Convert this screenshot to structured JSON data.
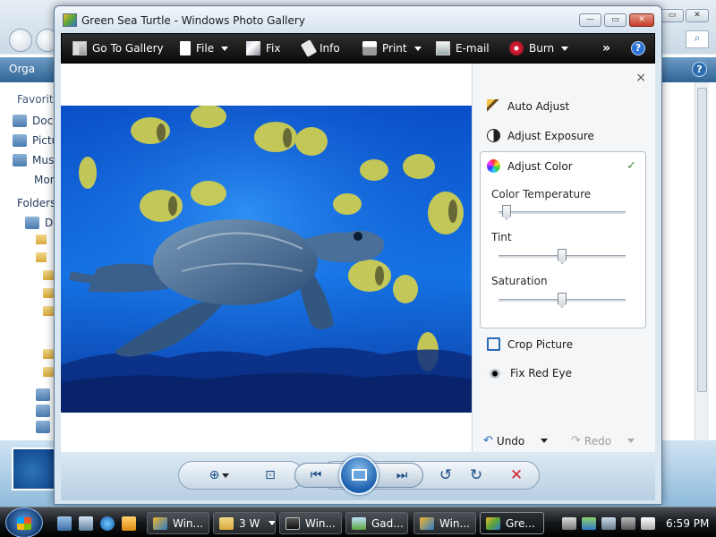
{
  "window_title": "Green Sea Turtle - Windows Photo Gallery",
  "caption_buttons": {
    "minimize": "—",
    "maximize": "▭",
    "close": "✕"
  },
  "toolbar": {
    "go_to_gallery": "Go To Gallery",
    "file": "File",
    "fix": "Fix",
    "info": "Info",
    "print": "Print",
    "email": "E-mail",
    "burn": "Burn",
    "more": "»",
    "help": "?"
  },
  "fix_pane": {
    "close": "×",
    "auto_adjust": "Auto Adjust",
    "adjust_exposure": "Adjust Exposure",
    "adjust_color": "Adjust Color",
    "check": "✓",
    "sliders": [
      {
        "label": "Color Temperature",
        "value": 0.03
      },
      {
        "label": "Tint",
        "value": 0.5
      },
      {
        "label": "Saturation",
        "value": 0.5
      }
    ],
    "crop_picture": "Crop Picture",
    "fix_red_eye": "Fix Red Eye",
    "undo": "Undo",
    "redo": "Redo"
  },
  "controls": {
    "zoom": "⊕",
    "actual_size": "⊡",
    "previous": "⏮",
    "next": "⏭",
    "rotate_ccw": "↺",
    "rotate_cw": "↻",
    "delete": "✕"
  },
  "background_window": {
    "search_icon": "⌕",
    "help": "?",
    "organize": "Orga",
    "favorites": "Favorite",
    "docs": "Doc",
    "pictures": "Pictu",
    "music": "Mus",
    "more": "Mor",
    "folders": "Folders",
    "desktop": "De"
  },
  "taskbar": {
    "tasks": [
      {
        "label": "Win...",
        "active": false
      },
      {
        "label": "3 W",
        "active": false
      },
      {
        "label": "Win...",
        "active": false
      },
      {
        "label": "Gad...",
        "active": false
      },
      {
        "label": "Win...",
        "active": false
      },
      {
        "label": "Gre...",
        "active": true
      }
    ],
    "clock": "6:59 PM"
  },
  "colors": {
    "toolbar_bg": "#0b0b0b",
    "accent": "#1b5fae",
    "delete": "#d0262b",
    "check": "#3c8d3c"
  }
}
